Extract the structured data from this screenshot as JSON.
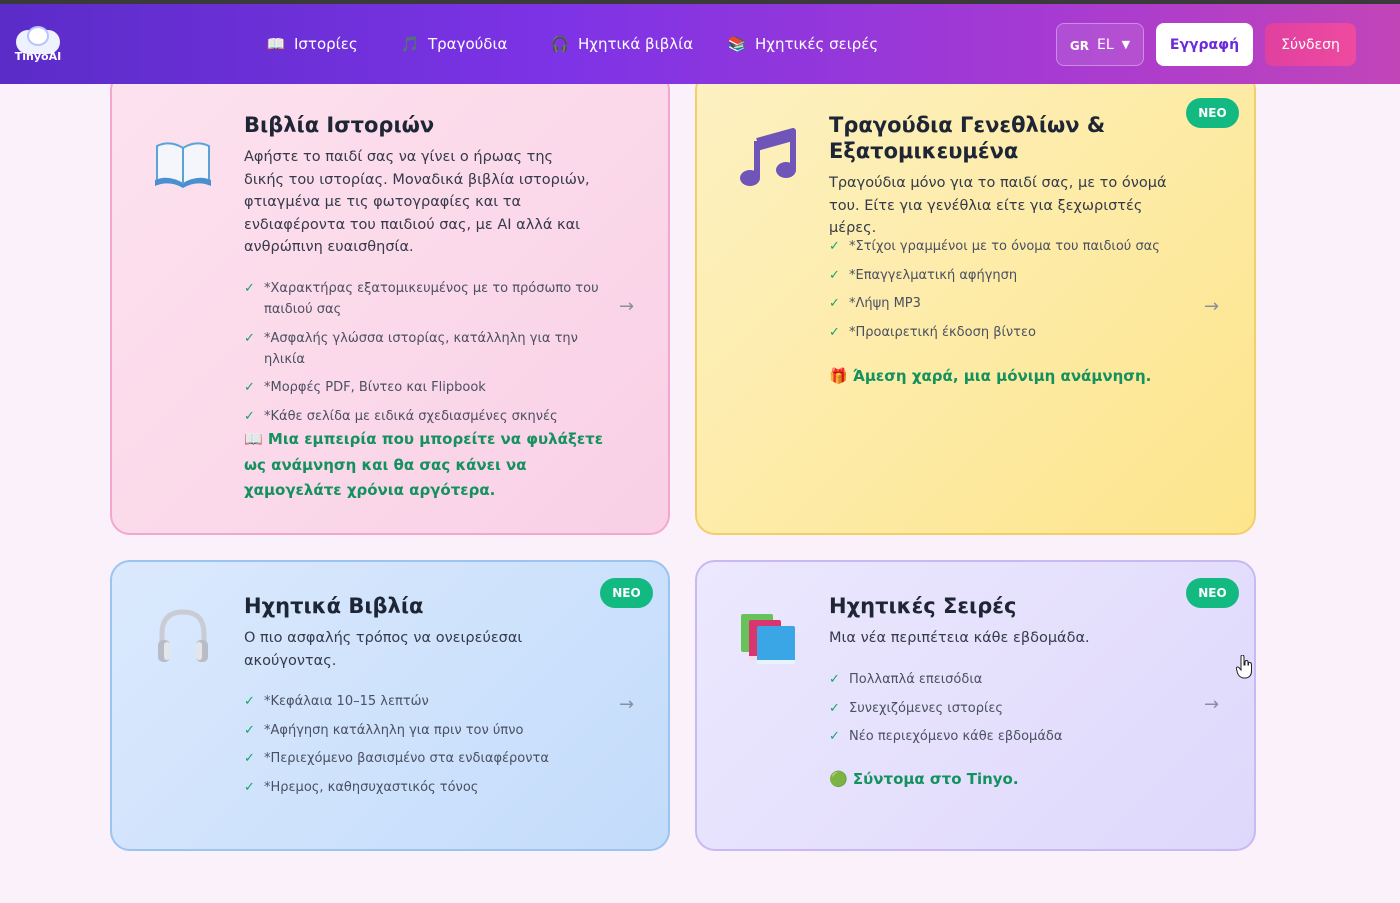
{
  "header": {
    "logo_text": "TinyoAI",
    "nav": [
      {
        "icon": "book-icon",
        "glyph": "📖",
        "label": "Ιστορίες"
      },
      {
        "icon": "music-note-icon",
        "glyph": "🎵",
        "label": "Τραγούδια"
      },
      {
        "icon": "headphones-icon",
        "glyph": "🎧",
        "label": "Ηχητικά βιβλία"
      },
      {
        "icon": "books-icon",
        "glyph": "📚",
        "label": "Ηχητικές σειρές"
      }
    ],
    "lang": {
      "flag": "GR",
      "code": "EL",
      "caret": "▼"
    },
    "register_label": "Εγγραφή",
    "login_label": "Σύνδεση"
  },
  "cards": [
    {
      "title": "Βιβλία Ιστοριών",
      "description": "Αφήστε το παιδί σας να γίνει ο ήρωας της δικής του ιστορίας. Μοναδικά βιβλία ιστοριών, φτιαγμένα με τις φωτογραφίες και τα ενδιαφέροντα του παιδιού σας, με AI αλλά και ανθρώπινη ευαισθησία.",
      "features": [
        "*Χαρακτήρας εξατομικευμένος με το πρόσωπο του παιδιού σας",
        "*Ασφαλής γλώσσα ιστορίας, κατάλληλη για την ηλικία",
        "*Μορφές PDF, Βίντεο και Flipbook",
        "*Κάθε σελίδα με ειδικά σχεδιασμένες σκηνές"
      ],
      "tagline": "📖 Μια εμπειρία που μπορείτε να φυλάξετε ως ανάμνηση και θα σας κάνει να χαμογελάτε χρόνια αργότερα.",
      "arrow": "→"
    },
    {
      "badge": "ΝΕΟ",
      "title": "Τραγούδια Γενεθλίων & Εξατομικευμένα",
      "description": "Τραγούδια μόνο για το παιδί σας, με το όνομά του. Είτε για γενέθλια είτε για ξεχωριστές μέρες.",
      "features": [
        "*Στίχοι γραμμένοι με το όνομα του παιδιού σας",
        "*Επαγγελματική αφήγηση",
        "*Λήψη MP3",
        "*Προαιρετική έκδοση βίντεο"
      ],
      "tagline": "🎁 Άμεση χαρά, μια μόνιμη ανάμνηση.",
      "arrow": "→"
    },
    {
      "badge": "ΝΕΟ",
      "title": "Ηχητικά Βιβλία",
      "description": "Ο πιο ασφαλής τρόπος να ονειρεύεσαι ακούγοντας.",
      "features": [
        "*Κεφάλαια 10–15 λεπτών",
        "*Αφήγηση κατάλληλη για πριν τον ύπνο",
        "*Περιεχόμενο βασισμένο στα ενδιαφέροντα",
        "*Ηρεμος, καθησυχαστικός τόνος"
      ],
      "arrow": "→"
    },
    {
      "badge": "ΝΕΟ",
      "title": "Ηχητικές Σειρές",
      "description": "Μια νέα περιπέτεια κάθε εβδομάδα.",
      "features": [
        "Πολλαπλά επεισόδια",
        "Συνεχιζόμενες ιστορίες",
        "Νέο περιεχόμενο κάθε εβδομάδα"
      ],
      "tagline": "🟢 Σύντομα στο Tinyo.",
      "arrow": "→"
    }
  ],
  "check_glyph": "✓",
  "colors": {
    "accent": "#7d33e6",
    "badge": "#12b981",
    "tagline": "#13915e",
    "login": "#e0409f"
  }
}
